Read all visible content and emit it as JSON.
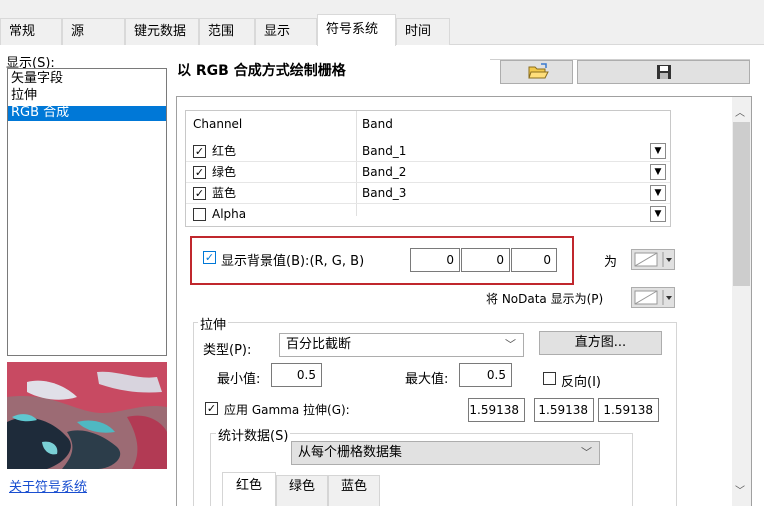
{
  "tabs": [
    "常规",
    "源",
    "键元数据",
    "范围",
    "显示",
    "符号系统",
    "时间"
  ],
  "display_label": "显示(S):",
  "display_items": [
    "矢量字段",
    "拉伸",
    "RGB 合成"
  ],
  "about_link": "关于符号系统",
  "panel_title": "以 RGB 合成方式绘制栅格",
  "table": {
    "headers": [
      "Channel",
      "Band"
    ],
    "rows": [
      {
        "channel": "红色",
        "band": "Band_1",
        "checked": true
      },
      {
        "channel": "绿色",
        "band": "Band_2",
        "checked": true
      },
      {
        "channel": "蓝色",
        "band": "Band_3",
        "checked": true
      },
      {
        "channel": "Alpha",
        "band": "",
        "checked": false
      }
    ]
  },
  "background": {
    "label": "显示背景值(B):(R, G, B)",
    "checked": true,
    "r": "0",
    "g": "0",
    "b": "0",
    "as_label": "为"
  },
  "nodata_label": "将 NoData 显示为(P)",
  "stretch": {
    "group_label": "拉伸",
    "type_label": "类型(P):",
    "type_value": "百分比截断",
    "histogram_button": "直方图...",
    "min_label": "最小值:",
    "min_value": "0.5",
    "max_label": "最大值:",
    "max_value": "0.5",
    "invert_label": "反向(I)",
    "gamma_label": "应用 Gamma 拉伸(G):",
    "gamma_values": [
      "1.59138",
      "1.59138",
      "1.59138"
    ],
    "stats_label": "统计数据(S)",
    "stats_source": "从每个栅格数据集",
    "stats_tabs": [
      "红色",
      "绿色",
      "蓝色"
    ]
  },
  "colors": {
    "accent": "#0078d7",
    "highlight_box": "#c0272d",
    "link": "#1a4fd0"
  },
  "icons": [
    "folder-open-icon",
    "save-icon",
    "chevron-down-icon",
    "scroll-up-icon",
    "scroll-down-icon"
  ]
}
